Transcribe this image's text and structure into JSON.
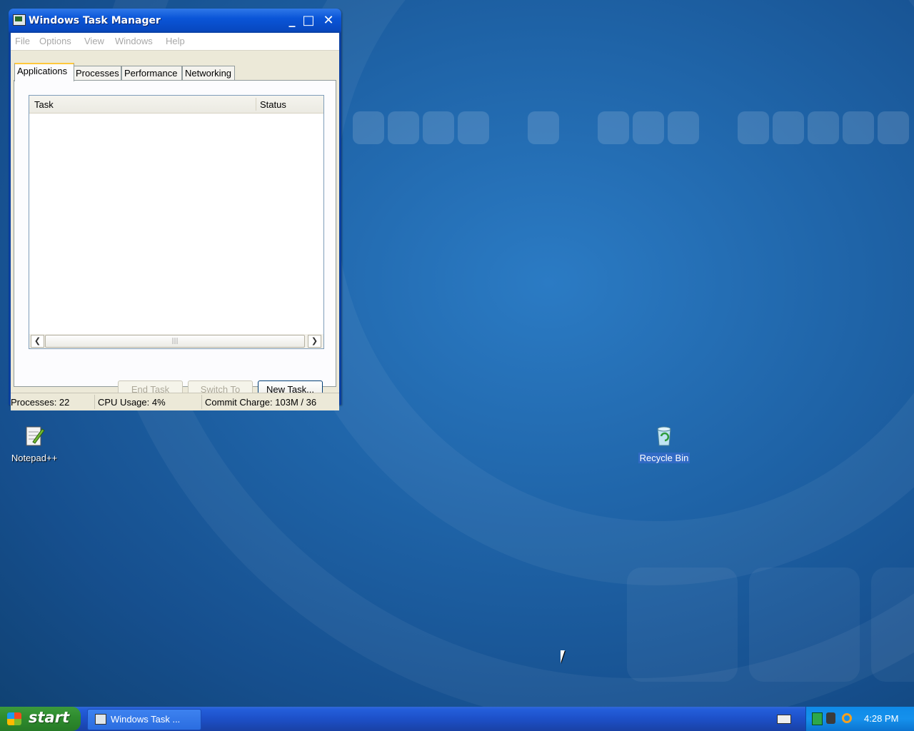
{
  "window": {
    "title": "Windows Task Manager",
    "menu": [
      "File",
      "Options",
      "View",
      "Windows",
      "Help"
    ],
    "tabs": [
      "Applications",
      "Processes",
      "Performance",
      "Networking"
    ],
    "active_tab": "Applications",
    "columns": [
      "Task",
      "Status"
    ],
    "buttons": {
      "end_task": "End Task",
      "switch_to": "Switch To",
      "new_task": "New Task..."
    },
    "status": {
      "processes": "Processes: 22",
      "cpu": "CPU Usage: 4%",
      "commit": "Commit Charge: 103M / 36"
    }
  },
  "desktop_icons": {
    "notepad": "Notepad++",
    "recycle": "Recycle Bin"
  },
  "taskbar": {
    "start": "start",
    "task_button": "Windows Task ...",
    "clock": "4:28 PM"
  },
  "colors": {
    "desktop": "#1f64a8",
    "titlebar": "#0a55d8",
    "start_green": "#2f8d2f",
    "tray_blue": "#1591ec"
  }
}
